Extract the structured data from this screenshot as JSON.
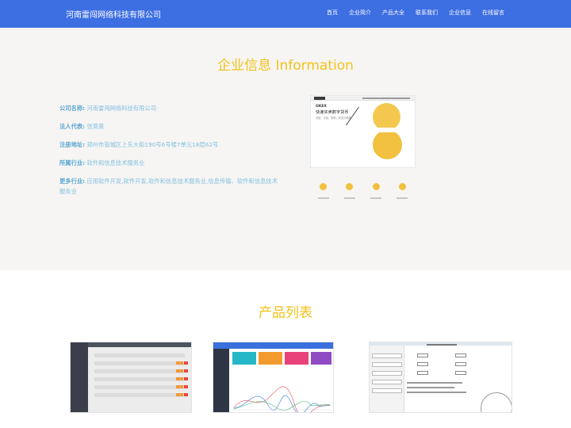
{
  "header": {
    "brand": "河南雷闯网络科技有限公司",
    "nav": [
      "首页",
      "企业简介",
      "产品大全",
      "联系我们",
      "企业信息",
      "在线留言"
    ]
  },
  "info": {
    "title": "企业信息 Information",
    "fields": [
      {
        "key": "公司名称:",
        "value": "河南雷闯网络科技有限公司"
      },
      {
        "key": "法人代表:",
        "value": "张莫莫"
      },
      {
        "key": "注册地址:",
        "value": "郑州市管城区上东大街190号6号楼7单元18层62号"
      },
      {
        "key": "所属行业:",
        "value": "软件和信息技术服务业"
      },
      {
        "key": "更多行业:",
        "value": "应用软件开发,软件开发,软件和信息技术服务业,信息传输、软件和信息技术服务业"
      }
    ],
    "screenshot": {
      "card_heading": "OKEX",
      "card_title": "快速买卖数字货币",
      "card_sub": "充值、交易、提现，安全又便捷"
    }
  },
  "products": {
    "title": "产品列表"
  },
  "colors": {
    "nav_bg": "#3d6ee2",
    "accent": "#f2c21a",
    "info_bg": "#f6f5f3",
    "label_blue": "#5aa8d2"
  }
}
